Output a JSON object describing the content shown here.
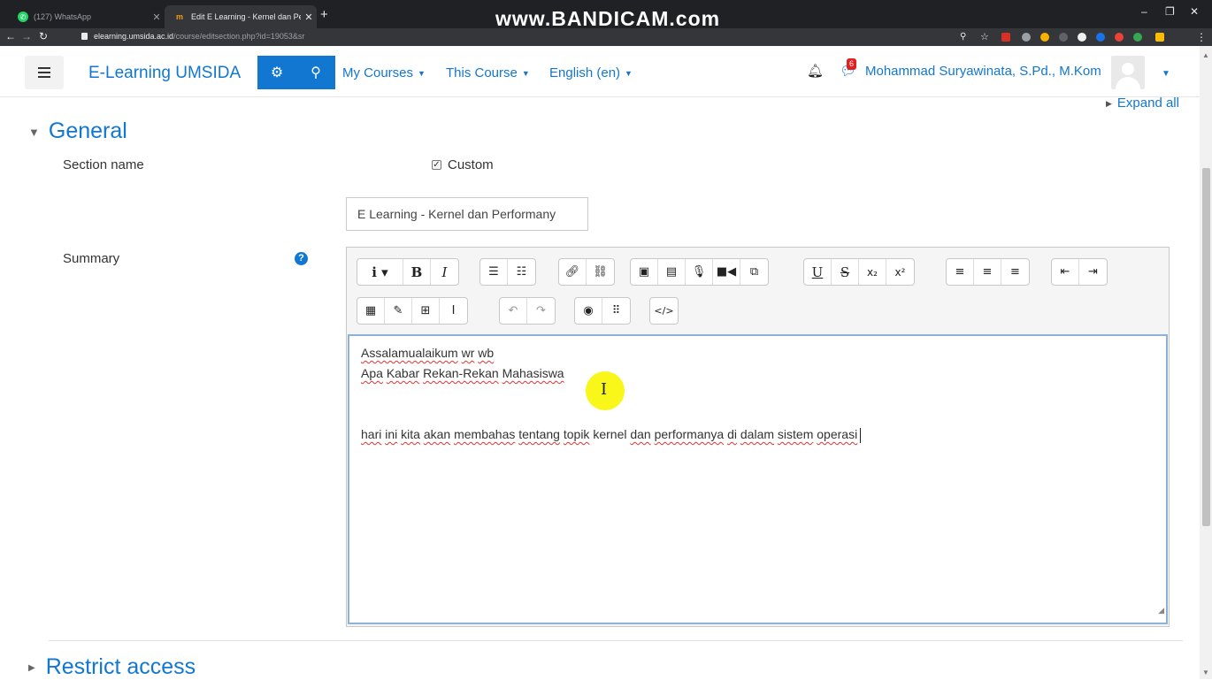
{
  "browser": {
    "tabs": [
      {
        "title": "(127) WhatsApp",
        "icon": "whatsapp-icon"
      },
      {
        "title": "Edit E Learning - Kernel dan Perf",
        "icon": "moodle-icon"
      }
    ],
    "new_tab": "+",
    "watermark": "www.BANDICAM.com",
    "url_host": "elearning.umsida.ac.id",
    "url_path": "/course/editsection.php?id=19053&sr",
    "win_min": "–",
    "win_max": "❐",
    "win_close": "✕"
  },
  "navbar": {
    "brand": "E-Learning UMSIDA",
    "menus": [
      "My Courses",
      "This Course",
      "English (en)"
    ],
    "notification_count": "6",
    "user_name": "Mohammad Suryawinata, S.Pd., M.Kom",
    "accent": "#1177d1"
  },
  "form": {
    "expand_all": "Expand all",
    "section_title": "General",
    "section_name_label": "Section name",
    "custom_label": "Custom",
    "custom_checked": true,
    "section_name_value": "E Learning - Kernel dan Performany",
    "summary_label": "Summary",
    "help_symbol": "?",
    "restrict_title": "Restrict access"
  },
  "editor": {
    "toolbar_row1": [
      [
        "paragraph-style",
        "bold",
        "italic"
      ],
      [
        "bullet-list",
        "numbered-list"
      ],
      [
        "link",
        "unlink"
      ],
      [
        "image",
        "media",
        "record-audio",
        "record-video",
        "manage-files"
      ],
      [
        "underline",
        "strikethrough",
        "subscript",
        "superscript"
      ],
      [
        "align-left",
        "align-center",
        "align-right"
      ],
      [
        "outdent",
        "indent"
      ]
    ],
    "toolbar_row2": [
      [
        "equation",
        "special-char",
        "table",
        "clear-formatting"
      ],
      [
        "undo",
        "redo"
      ],
      [
        "accessibility-checker",
        "screenreader-helper"
      ],
      [
        "html"
      ]
    ],
    "lines": [
      "Assalamualaikum wr wb",
      "Apa Kabar Rekan-Rekan Mahasiswa",
      "",
      "",
      "hari ini kita akan membahas tentang topik kernel dan performanya di dalam sistem operasi"
    ]
  }
}
